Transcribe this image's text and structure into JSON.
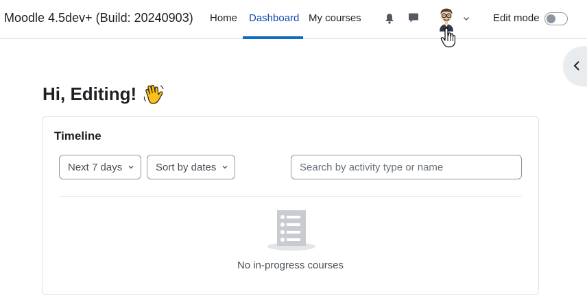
{
  "header": {
    "brand": "Moodle 4.5dev+ (Build: 20240903)",
    "nav": [
      {
        "label": "Home",
        "active": false
      },
      {
        "label": "Dashboard",
        "active": true
      },
      {
        "label": "My courses",
        "active": false
      }
    ],
    "edit_mode_label": "Edit mode",
    "edit_mode_on": false,
    "icons": [
      "bell-icon",
      "chat-icon",
      "avatar",
      "chevron-down-icon"
    ]
  },
  "main": {
    "greeting": "Hi, Editing!",
    "greeting_emoji": "waving-hand-icon"
  },
  "timeline": {
    "title": "Timeline",
    "filter_label": "Next 7 days",
    "sort_label": "Sort by dates",
    "search_placeholder": "Search by activity type or name",
    "search_value": "",
    "empty_message": "No in-progress courses"
  },
  "colors": {
    "accent": "#0f6cbf",
    "active_link": "#0f47ad",
    "border": "#dee2e6",
    "muted_icon": "#c8cbd0"
  }
}
